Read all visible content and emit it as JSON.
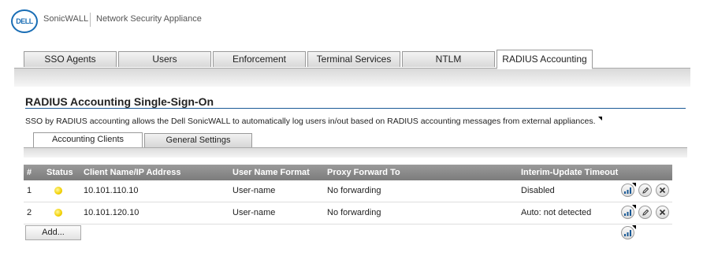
{
  "header": {
    "logo": "DELL",
    "brand": "SonicWALL",
    "app_name": "Network Security Appliance"
  },
  "top_tabs": [
    {
      "label": "SSO Agents",
      "active": false
    },
    {
      "label": "Users",
      "active": false
    },
    {
      "label": "Enforcement",
      "active": false
    },
    {
      "label": "Terminal Services",
      "active": false
    },
    {
      "label": "NTLM",
      "active": false
    },
    {
      "label": "RADIUS Accounting",
      "active": true
    }
  ],
  "page": {
    "title": "RADIUS Accounting Single-Sign-On",
    "description": "SSO by RADIUS accounting allows the Dell SonicWALL to automatically log users in/out based on RADIUS accounting messages from external appliances."
  },
  "sub_tabs": [
    {
      "label": "Accounting Clients",
      "active": true
    },
    {
      "label": "General Settings",
      "active": false
    }
  ],
  "table": {
    "headers": [
      "#",
      "Status",
      "Client Name/IP Address",
      "User Name Format",
      "Proxy Forward To",
      "Interim-Update Timeout"
    ],
    "rows": [
      {
        "num": "1",
        "status": "yellow",
        "client": "10.101.110.10",
        "user_format": "User-name",
        "proxy": "No forwarding",
        "timeout": "Disabled"
      },
      {
        "num": "2",
        "status": "yellow",
        "client": "10.101.120.10",
        "user_format": "User-name",
        "proxy": "No forwarding",
        "timeout": "Auto: not detected"
      }
    ],
    "row_actions": [
      "stats-icon",
      "edit-icon",
      "delete-icon"
    ]
  },
  "add_button": "Add...",
  "colors": {
    "accent": "#1a5a96",
    "status_yellow": "#f2d000",
    "header_bg": "#8a8a8a"
  }
}
